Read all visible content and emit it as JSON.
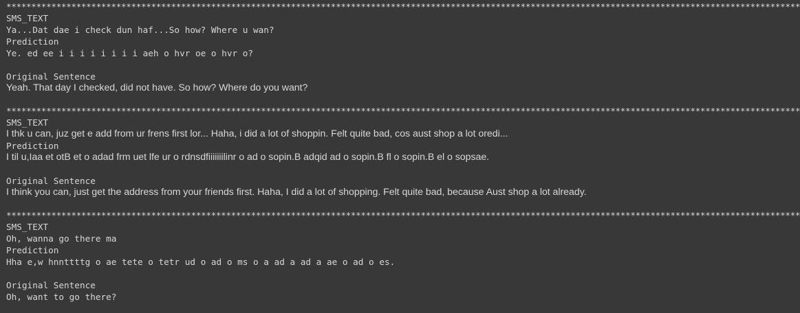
{
  "separator": "************************************************************************************************************************************************************************************************************************",
  "labels": {
    "sms": "SMS_TEXT",
    "prediction": "Prediction",
    "original": "Original Sentence"
  },
  "records": [
    {
      "sms_text": "Ya...Dat dae i check dun haf...So how? Where u wan?",
      "prediction": "Ye. ed ee i i i i i i i i aeh o hvr oe o hvr o?",
      "original": "Yeah. That day I checked, did not have. So how? Where do you want?"
    },
    {
      "sms_text": "I thk u can, juz get e add from ur frens first lor... Haha, i did a lot of shoppin. Felt quite bad, cos aust shop a lot oredi...",
      "prediction": "I til u,Iaa et otB et o adad frm uet lfe ur o rdnsdfiiiiiiilinr o ad o sopin.B adqid ad o sopin.B fl o sopin.B el o sopsae.",
      "original": "I think you can, just get the address from your friends first. Haha, I did a lot of shopping. Felt quite bad, because Aust shop a lot already."
    },
    {
      "sms_text": "Oh, wanna go there ma",
      "prediction": "Hha e,w hnnttttg o ae tete o tetr ud o ad o ms o a ad a ad a ae o ad o es.",
      "original": "Oh, want to go there?"
    }
  ]
}
